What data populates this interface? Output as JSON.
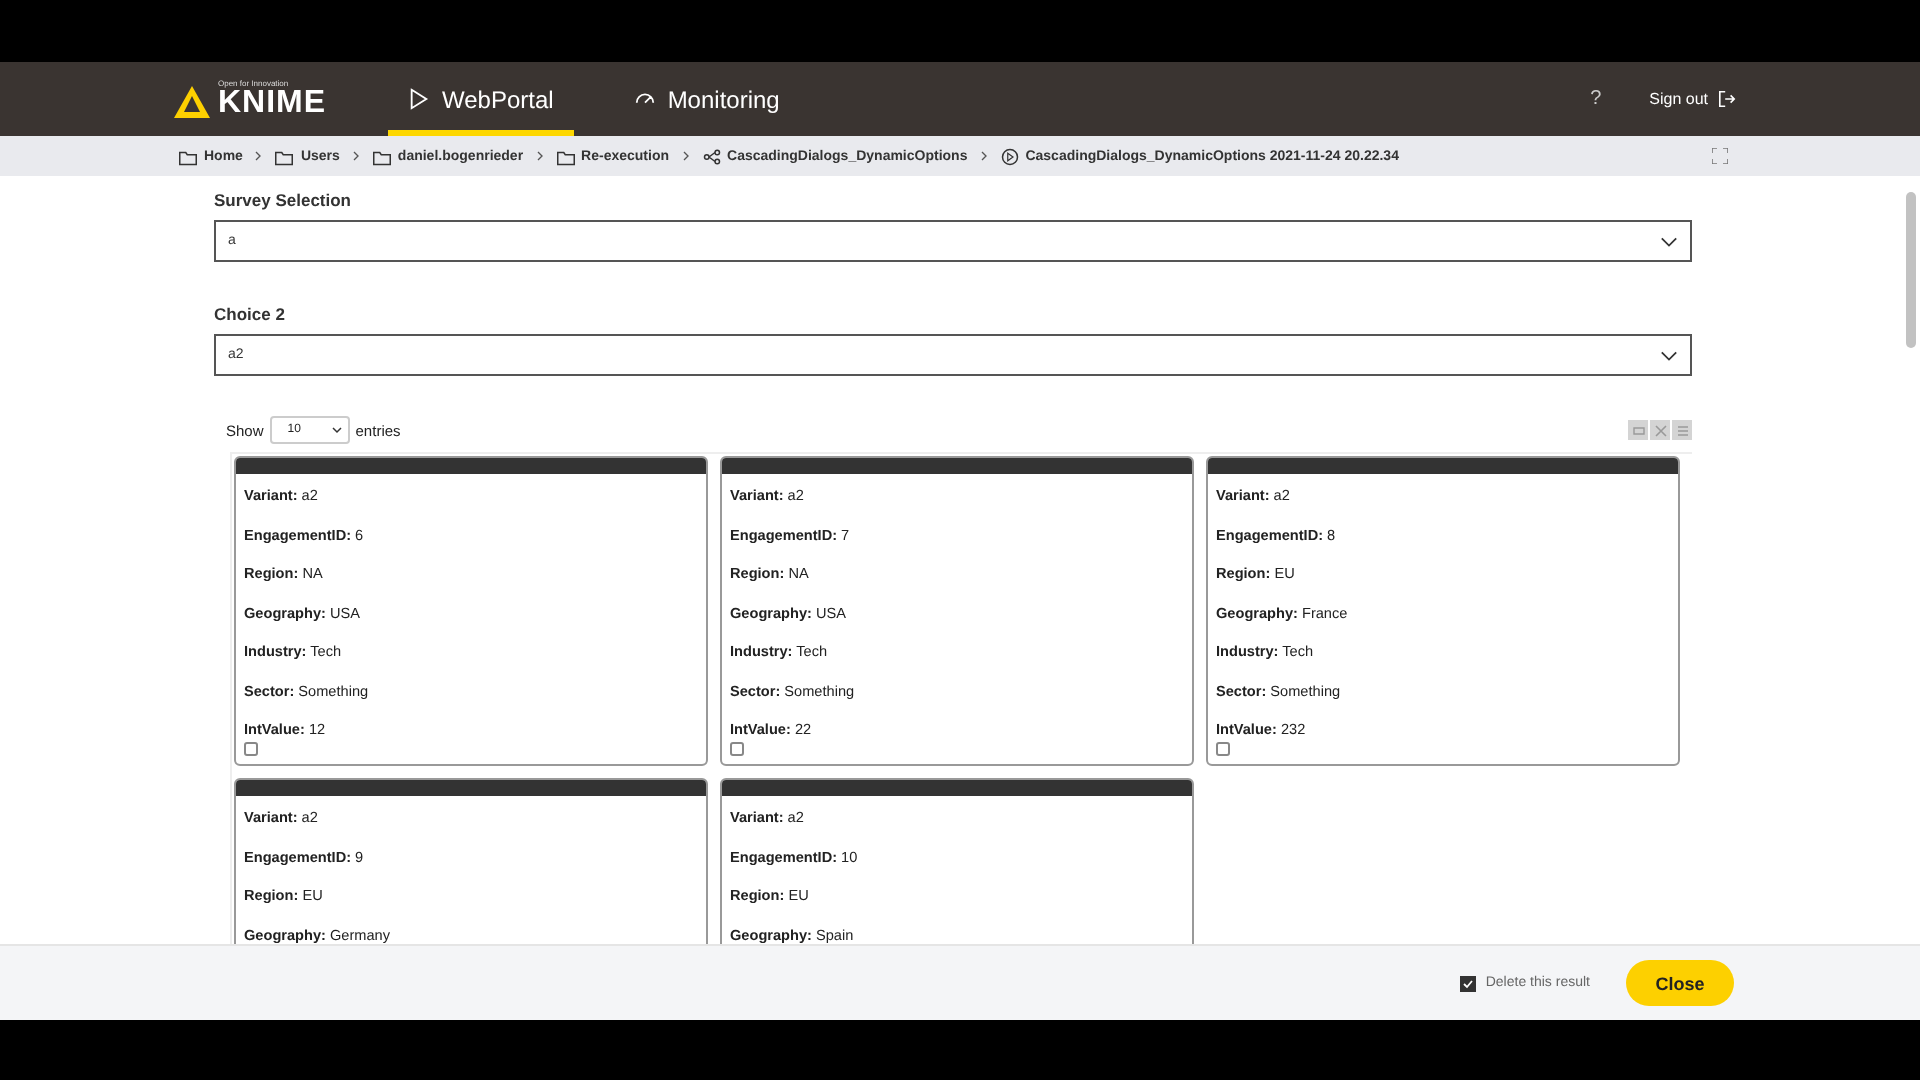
{
  "header": {
    "logo": {
      "tagline": "Open for Innovation",
      "name": "KNIME"
    },
    "nav": [
      {
        "label": "WebPortal",
        "selected": true,
        "kind": "play"
      },
      {
        "label": "Monitoring",
        "selected": false,
        "kind": "monitor"
      }
    ],
    "help": "?",
    "sign_out": "Sign out"
  },
  "breadcrumb": [
    {
      "label": "Home",
      "kind": "folder"
    },
    {
      "label": "Users",
      "kind": "folder"
    },
    {
      "label": "daniel.bogenrieder",
      "kind": "folder"
    },
    {
      "label": "Re-execution",
      "kind": "folder"
    },
    {
      "label": "CascadingDialogs_DynamicOptions",
      "kind": "workflow"
    },
    {
      "label": "CascadingDialogs_DynamicOptions 2021-11-24 20.22.34",
      "kind": "job"
    }
  ],
  "form": [
    {
      "label": "Survey Selection",
      "value": "a"
    },
    {
      "label": "Choice 2",
      "value": "a2"
    }
  ],
  "table": {
    "show_label": "Show",
    "page_size": "10",
    "entries_label": "entries",
    "cards": [
      {
        "fields": [
          {
            "label": "Variant:",
            "value": "a2"
          },
          {
            "label": "EngagementID:",
            "value": "6"
          },
          {
            "label": "Region:",
            "value": "NA"
          },
          {
            "label": "Geography:",
            "value": "USA"
          },
          {
            "label": "Industry:",
            "value": "Tech"
          },
          {
            "label": "Sector:",
            "value": "Something"
          },
          {
            "label": "IntValue:",
            "value": "12"
          }
        ],
        "checked": false
      },
      {
        "fields": [
          {
            "label": "Variant:",
            "value": "a2"
          },
          {
            "label": "EngagementID:",
            "value": "7"
          },
          {
            "label": "Region:",
            "value": "NA"
          },
          {
            "label": "Geography:",
            "value": "USA"
          },
          {
            "label": "Industry:",
            "value": "Tech"
          },
          {
            "label": "Sector:",
            "value": "Something"
          },
          {
            "label": "IntValue:",
            "value": "22"
          }
        ],
        "checked": false
      },
      {
        "fields": [
          {
            "label": "Variant:",
            "value": "a2"
          },
          {
            "label": "EngagementID:",
            "value": "8"
          },
          {
            "label": "Region:",
            "value": "EU"
          },
          {
            "label": "Geography:",
            "value": "France"
          },
          {
            "label": "Industry:",
            "value": "Tech"
          },
          {
            "label": "Sector:",
            "value": "Something"
          },
          {
            "label": "IntValue:",
            "value": "232"
          }
        ],
        "checked": false
      },
      {
        "fields": [
          {
            "label": "Variant:",
            "value": "a2"
          },
          {
            "label": "EngagementID:",
            "value": "9"
          },
          {
            "label": "Region:",
            "value": "EU"
          },
          {
            "label": "Geography:",
            "value": "Germany"
          }
        ]
      },
      {
        "fields": [
          {
            "label": "Variant:",
            "value": "a2"
          },
          {
            "label": "EngagementID:",
            "value": "10"
          },
          {
            "label": "Region:",
            "value": "EU"
          },
          {
            "label": "Geography:",
            "value": "Spain"
          }
        ]
      }
    ]
  },
  "footer": {
    "delete_label": "Delete this result",
    "delete_checked": true,
    "close": "Close"
  }
}
